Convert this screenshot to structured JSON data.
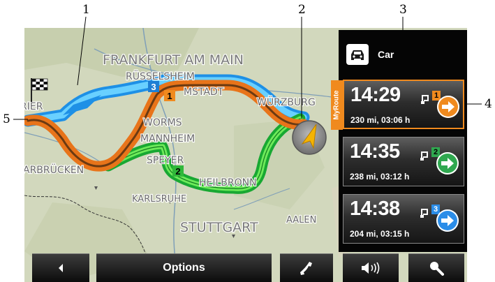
{
  "map": {
    "labels": {
      "frankfurt": "FRANKFURT AM MAIN",
      "ruesselsheim": "RÜSSELSHEIM",
      "darmstadt": "MSTADT",
      "wuerzburg": "WÜRZBURG",
      "worms": "WORMS",
      "mannheim": "MANNHEIM",
      "saarbruecken": "ARBRÜCKEN",
      "speyer": "SPEYER",
      "heilbronn": "HEILBRONN",
      "karlsruhe": "KARLSRUHE",
      "stuttgart": "STUTTGART",
      "aalen": "AALEN",
      "trier": "RIER"
    },
    "route_badges": [
      "1",
      "2",
      "3"
    ]
  },
  "panel": {
    "vehicle_label": "Car",
    "myroute_label": "MyRoute",
    "routes": [
      {
        "time": "14:29",
        "info": "230 mi, 03:06 h",
        "number": "1",
        "color": "#f08a1e",
        "selected": true
      },
      {
        "time": "14:35",
        "info": "238 mi, 03:12 h",
        "number": "2",
        "color": "#2fa84f",
        "selected": false
      },
      {
        "time": "14:38",
        "info": "204 mi, 03:15 h",
        "number": "3",
        "color": "#2b8de8",
        "selected": false
      }
    ]
  },
  "toolbar": {
    "options_label": "Options"
  },
  "callouts": [
    "1",
    "2",
    "3",
    "4",
    "5"
  ],
  "icons": [
    "car-icon",
    "flag-icon",
    "arrow-right-icon",
    "back-icon",
    "phone-icon",
    "volume-icon",
    "search-icon",
    "position-arrow-icon",
    "checkered-flag-icon"
  ]
}
